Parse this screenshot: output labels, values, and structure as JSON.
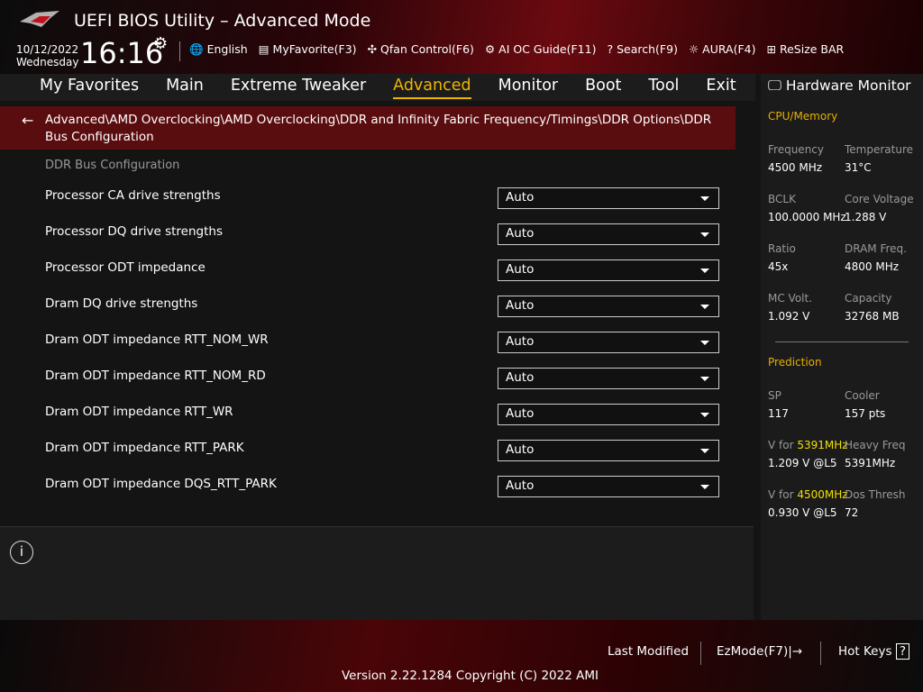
{
  "header": {
    "title": "UEFI BIOS Utility – Advanced Mode",
    "date": "10/12/2022",
    "day": "Wednesday",
    "time": "16:16",
    "tools": [
      {
        "icon": "globe-icon",
        "glyph": "🌐",
        "label": "English"
      },
      {
        "icon": "favorite-icon",
        "glyph": "▤",
        "label": "MyFavorite(F3)"
      },
      {
        "icon": "fan-icon",
        "glyph": "✣",
        "label": "Qfan Control(F6)"
      },
      {
        "icon": "ai-oc-icon",
        "glyph": "⚙",
        "label": "AI OC Guide(F11)"
      },
      {
        "icon": "search-icon",
        "glyph": "?",
        "label": "Search(F9)"
      },
      {
        "icon": "aura-icon",
        "glyph": "☼",
        "label": "AURA(F4)"
      },
      {
        "icon": "resize-bar-icon",
        "glyph": "⊞",
        "label": "ReSize BAR"
      }
    ]
  },
  "nav": [
    "My Favorites",
    "Main",
    "Extreme Tweaker",
    "Advanced",
    "Monitor",
    "Boot",
    "Tool",
    "Exit"
  ],
  "breadcrumb": "Advanced\\AMD Overclocking\\AMD Overclocking\\DDR and Infinity Fabric Frequency/Timings\\DDR Options\\DDR Bus Configuration",
  "section": "DDR Bus Configuration",
  "settings": [
    {
      "label": "Processor CA drive strengths",
      "value": "Auto"
    },
    {
      "label": "Processor DQ drive strengths",
      "value": "Auto"
    },
    {
      "label": "Processor ODT impedance",
      "value": "Auto"
    },
    {
      "label": "Dram DQ drive strengths",
      "value": "Auto"
    },
    {
      "label": "Dram ODT impedance RTT_NOM_WR",
      "value": "Auto"
    },
    {
      "label": "Dram ODT impedance RTT_NOM_RD",
      "value": "Auto"
    },
    {
      "label": "Dram ODT impedance RTT_WR",
      "value": "Auto"
    },
    {
      "label": "Dram ODT impedance RTT_PARK",
      "value": "Auto"
    },
    {
      "label": "Dram ODT impedance DQS_RTT_PARK",
      "value": "Auto"
    }
  ],
  "hw": {
    "title": "Hardware Monitor",
    "cpu_title": "CPU/Memory",
    "cpu": [
      [
        "Frequency",
        "4500 MHz"
      ],
      [
        "Temperature",
        "31°C"
      ],
      [
        "BCLK",
        "100.0000 MHz"
      ],
      [
        "Core Voltage",
        "1.288 V"
      ],
      [
        "Ratio",
        "45x"
      ],
      [
        "DRAM Freq.",
        "4800 MHz"
      ],
      [
        "MC Volt.",
        "1.092 V"
      ],
      [
        "Capacity",
        "32768 MB"
      ]
    ],
    "pred_title": "Prediction",
    "pred": {
      "sp_l": "SP",
      "sp": "117",
      "cooler_l": "Cooler",
      "cooler": "157 pts",
      "vfor": "V for",
      "f1": "5391MHz",
      "v1": "1.209 V @L5",
      "heavy_l": "Heavy Freq",
      "heavy": "5391MHz",
      "f2": "4500MHz",
      "v2": "0.930 V @L5",
      "dos_l": "Dos Thresh",
      "dos": "72"
    }
  },
  "footer": {
    "last": "Last Modified",
    "ez": "EzMode(F7)|→",
    "hot": "Hot Keys",
    "hot_icon": "?",
    "version": "Version 2.22.1284 Copyright (C) 2022 AMI"
  }
}
